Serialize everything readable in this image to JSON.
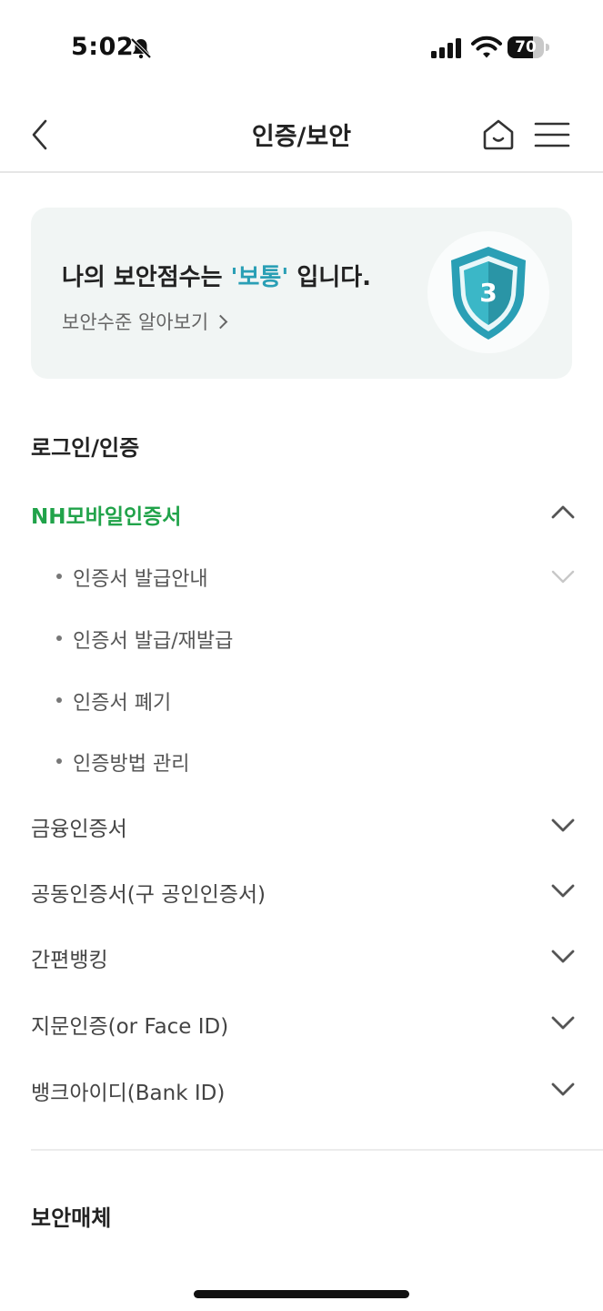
{
  "status_bar": {
    "time": "5:02",
    "battery": "70",
    "battery_level": 0.7
  },
  "header": {
    "title": "인증/보안"
  },
  "security_card": {
    "title_prefix": "나의 보안점수는 ",
    "level": "'보통'",
    "title_suffix": " 입니다.",
    "link_label": "보안수준 알아보기",
    "score": "3",
    "accent_color": "#2a9fb5"
  },
  "login_section": {
    "title": "로그인/인증",
    "groups": [
      {
        "label": "NH모바일인증서",
        "expanded": true,
        "items": [
          "인증서 발급안내",
          "인증서 발급/재발급",
          "인증서 폐기",
          "인증방법 관리"
        ]
      },
      {
        "label": "금융인증서",
        "expanded": false
      },
      {
        "label": "공동인증서(구 공인인증서)",
        "expanded": false
      },
      {
        "label": "간편뱅킹",
        "expanded": false
      },
      {
        "label": "지문인증(or Face ID)",
        "expanded": false
      },
      {
        "label": "뱅크아이디(Bank ID)",
        "expanded": false
      }
    ]
  },
  "media_section": {
    "title": "보안매체"
  },
  "colors": {
    "active": "#21a34a",
    "accent": "#2a9fb5"
  }
}
